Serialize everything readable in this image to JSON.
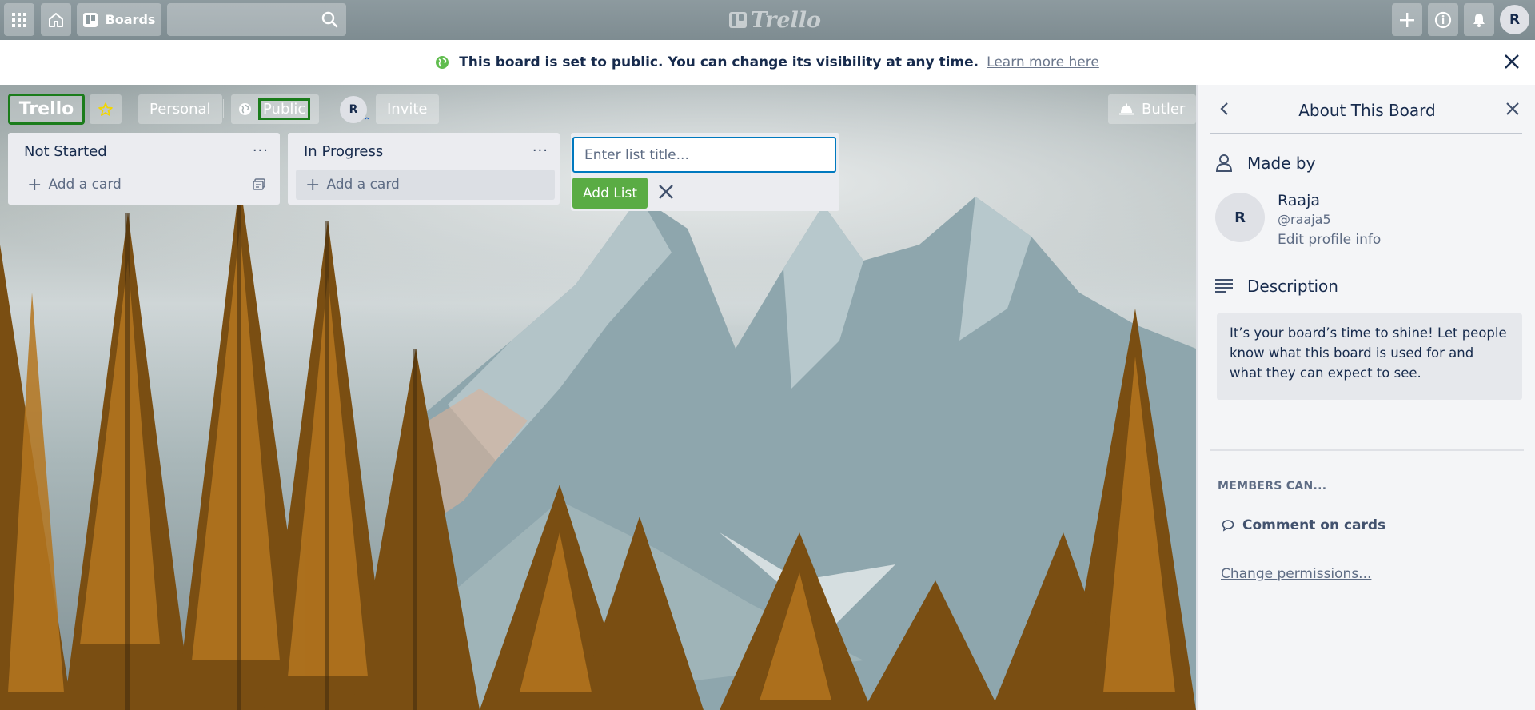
{
  "header": {
    "boards_label": "Boards",
    "logo_text": "Trello",
    "avatar_initial": "R",
    "icons": [
      "apps-icon",
      "home-icon",
      "boards-icon",
      "search-icon",
      "plus-icon",
      "info-icon",
      "bell-icon"
    ]
  },
  "banner": {
    "text": "This board is set to public. You can change its visibility at any time.",
    "link": "Learn more here",
    "accent": "#61bd4f"
  },
  "board": {
    "title": "Trello",
    "team": "Personal",
    "visibility": "Public",
    "member_initial": "R",
    "invite": "Invite",
    "butler": "Butler",
    "star_color": "#f2d600"
  },
  "lists": [
    {
      "title": "Not Started",
      "add_card": "Add a card",
      "menu": "···"
    },
    {
      "title": "In Progress",
      "add_card": "Add a card",
      "menu": "···"
    }
  ],
  "new_list": {
    "placeholder": "Enter list title...",
    "add_button": "Add List",
    "add_color": "#5aac44",
    "focus_color": "#0079bf"
  },
  "sidebar": {
    "title": "About This Board",
    "made_by": {
      "heading": "Made by",
      "initial": "R",
      "name": "Raaja",
      "handle": "@raaja5",
      "edit": "Edit profile info"
    },
    "description": {
      "heading": "Description",
      "text": "It’s your board’s time to shine! Let people know what this board is used for and what they can expect to see."
    },
    "members_can": "MEMBERS CAN...",
    "permission": "Comment on cards",
    "change_permissions": "Change permissions..."
  }
}
